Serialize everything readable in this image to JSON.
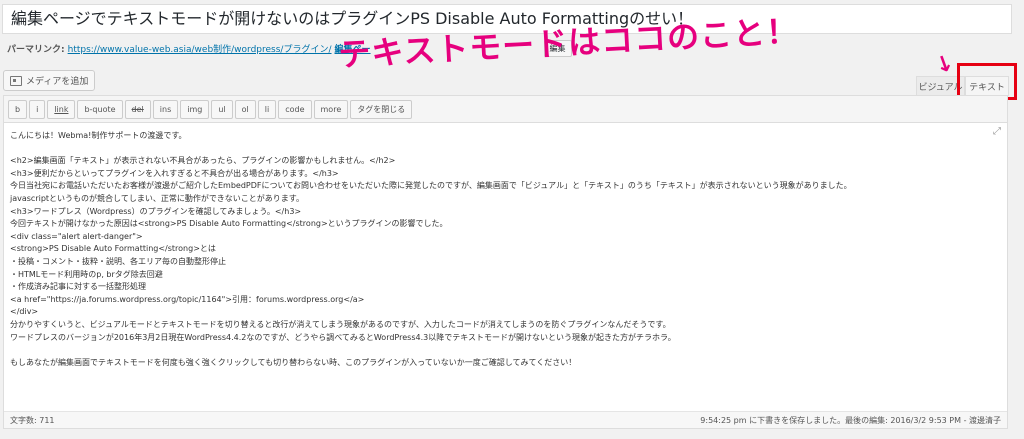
{
  "title": "編集ページでテキストモードが開けないのはプラグインPS Disable Auto Formattingのせい！",
  "permalink": {
    "label": "パーマリンク:",
    "url": "https://www.value-web.asia/web制作/wordpress/プラグイン/",
    "slug": "編集ペー",
    "edit_label": "編集"
  },
  "annotation": "テキストモードはココのこと！",
  "arrow_glyph": "↘",
  "media_button_label": "メディアを追加",
  "tabs": {
    "visual": "ビジュアル",
    "text": "テキスト"
  },
  "quicktags": [
    "b",
    "i",
    "link",
    "b-quote",
    "del",
    "ins",
    "img",
    "ul",
    "ol",
    "li",
    "code",
    "more",
    "タグを閉じる"
  ],
  "expand_glyph": "⤢",
  "content_lines": [
    "こんにちは！Webma!制作サポートの渡邊です。",
    "",
    "<h2>編集画面「テキスト」が表示されない不具合があったら、プラグインの影響かもしれません。</h2>",
    "<h3>便利だからといってプラグインを入れすぎると不具合が出る場合があります。</h3>",
    "今日当社宛にお電話いただいたお客様が渡邊がご紹介したEmbedPDFについてお問い合わせをいただいた際に発覚したのですが、編集画面で「ビジュアル」と「テキスト」のうち「テキスト」が表示されないという現象がありました。",
    "javascriptというものが競合してしまい、正常に動作ができないことがあります。",
    "<h3>ワードプレス（Wordpress）のプラグインを確認してみましょう。</h3>",
    "今回テキストが開けなかった原因は<strong>PS Disable Auto Formatting</strong>というプラグインの影響でした。",
    "<div class=\"alert alert-danger\">",
    "<strong>PS Disable Auto Formatting</strong>とは",
    "・投稿・コメント・抜粋・説明、各エリア毎の自動整形停止",
    "・HTMLモード利用時のp, brタグ除去回避",
    "・作成済み記事に対する一括整形処理",
    "<a href=\"https://ja.forums.wordpress.org/topic/1164\">引用：forums.wordpress.org</a>",
    "</div>",
    "分かりやすくいうと、ビジュアルモードとテキストモードを切り替えると改行が消えてしまう現象があるのですが、入力したコードが消えてしまうのを防ぐプラグインなんだそうです。",
    "ワードプレスのバージョンが2016年3月2日現在WordPress4.4.2なのですが、どうやら調べてみるとWordPress4.3以降でテキストモードが開けないという現象が起きた方がチラホラ。",
    "",
    "もしあなたが編集画面でテキストモードを何度も強く強くクリックしても切り替わらない時、このプラグインが入っていないか一度ご確認してみてください！"
  ],
  "status": {
    "word_count": "文字数: 711",
    "saved": "9:54:25 pm に下書きを保存しました。最後の編集: 2016/3/2 9:53 PM - 渡邊清子"
  },
  "colors": {
    "annotation": "#e6007e",
    "highlight_box": "#e60012",
    "link": "#0073aa"
  }
}
